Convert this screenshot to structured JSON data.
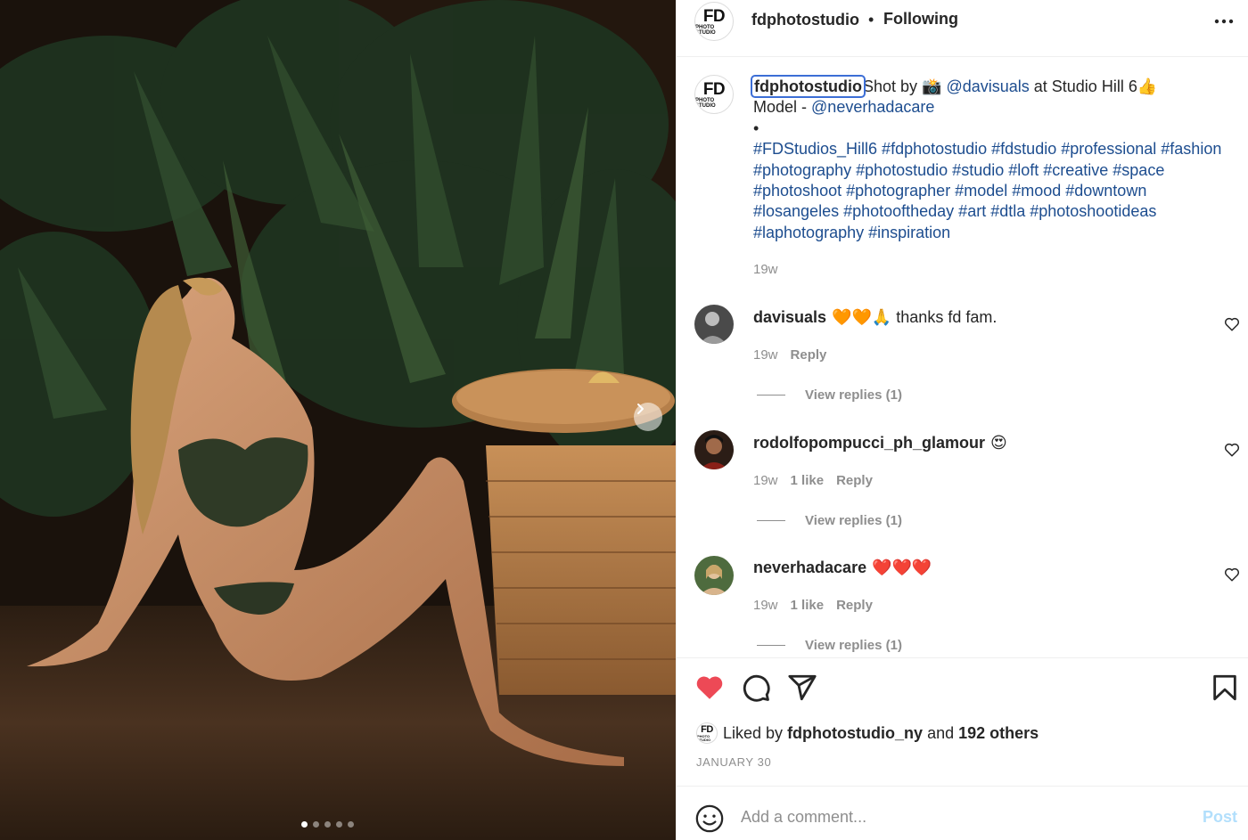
{
  "post": {
    "carousel": {
      "count": 5,
      "active_index": 0
    }
  },
  "header": {
    "logo_text": "FD",
    "logo_subtext": "PHOTO STUDIO",
    "username": "fdphotostudio",
    "separator": "•",
    "follow_status": "Following"
  },
  "caption": {
    "owner": "fdphotostudio",
    "line1_pre": "Shot by 📸 ",
    "photographer": "@davisuals",
    "line1_post": " at Studio Hill 6👍",
    "line2_pre": "Model - ",
    "model": "@neverhadacare",
    "bullet": "•",
    "hashtags": "#FDStudios_Hill6 #fdphotostudio #fdstudio #professional #fashion #photography #photostudio #studio #loft #creative #space #photoshoot #photographer #model #mood #downtown #losangeles #photooftheday #art #dtla #photoshootideas #laphotography #inspiration",
    "time": "19w"
  },
  "comments": [
    {
      "username": "davisuals",
      "text": "🧡🧡🙏 thanks fd fam.",
      "time": "19w",
      "likes": "",
      "reply_label": "Reply",
      "view_replies": "View replies (1)"
    },
    {
      "username": "rodolfopompucci_ph_glamour",
      "text": "😍",
      "time": "19w",
      "likes": "1 like",
      "reply_label": "Reply",
      "view_replies": "View replies (1)"
    },
    {
      "username": "neverhadacare",
      "text": "❤️❤️❤️",
      "time": "19w",
      "likes": "1 like",
      "reply_label": "Reply",
      "view_replies": "View replies (1)"
    }
  ],
  "actions": {
    "liked_by_prefix": "Liked by",
    "liked_by_user": "fdphotostudio_ny",
    "liked_by_and": "and",
    "liked_by_others": "192 others",
    "date": "JANUARY 30",
    "like_color": "#ed4956"
  },
  "composer": {
    "placeholder": "Add a comment...",
    "post_label": "Post"
  },
  "icons": [
    "chevron-right-icon",
    "more-icon",
    "heart-icon",
    "comment-icon",
    "share-icon",
    "bookmark-icon",
    "emoji-icon"
  ]
}
